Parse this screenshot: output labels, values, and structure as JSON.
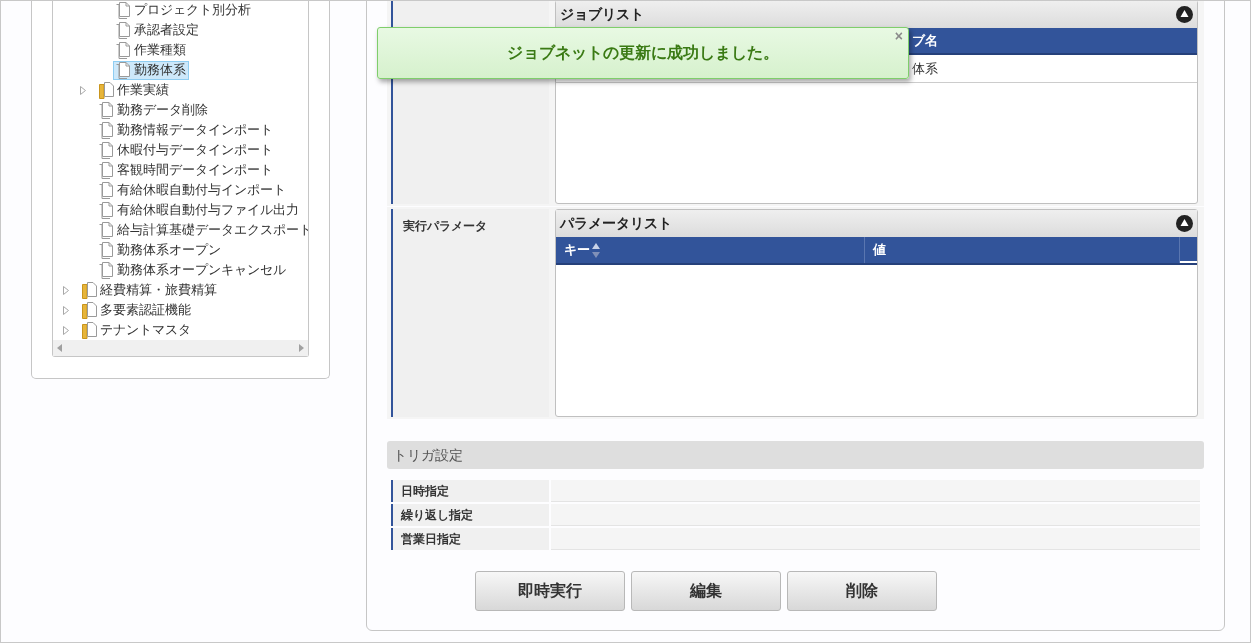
{
  "tree": {
    "items": [
      {
        "kind": "group",
        "children": [
          {
            "kind": "group",
            "children": [
              {
                "kind": "page",
                "label": "プロジェクト別分析",
                "selected": false
              },
              {
                "kind": "page",
                "label": "承認者設定",
                "selected": false
              },
              {
                "kind": "page",
                "label": "作業種類",
                "selected": false
              },
              {
                "kind": "page",
                "label": "勤務体系",
                "selected": true
              }
            ]
          },
          {
            "kind": "folder",
            "label": "作業実績",
            "expanded": false,
            "selected": false
          },
          {
            "kind": "page",
            "label": "勤務データ削除",
            "selected": false
          },
          {
            "kind": "page",
            "label": "勤務情報データインポート",
            "selected": false
          },
          {
            "kind": "page",
            "label": "休暇付与データインポート",
            "selected": false
          },
          {
            "kind": "page",
            "label": "客観時間データインポート",
            "selected": false
          },
          {
            "kind": "page",
            "label": "有給休暇自動付与インポート",
            "selected": false
          },
          {
            "kind": "page",
            "label": "有給休暇自動付与ファイル出力",
            "selected": false
          },
          {
            "kind": "page",
            "label": "給与計算基礎データエクスポート",
            "selected": false
          },
          {
            "kind": "page",
            "label": "勤務体系オープン",
            "selected": false
          },
          {
            "kind": "page",
            "label": "勤務体系オープンキャンセル",
            "selected": false
          }
        ]
      },
      {
        "kind": "folder",
        "label": "経費精算・旅費精算",
        "expanded": false,
        "selected": false
      },
      {
        "kind": "folder",
        "label": "多要素認証機能",
        "expanded": false,
        "selected": false
      },
      {
        "kind": "folder",
        "label": "テナントマスタ",
        "expanded": false,
        "selected": false
      }
    ]
  },
  "job_list": {
    "title": "ジョブリスト",
    "columns": [
      "",
      "ブ名"
    ],
    "rows": [
      [
        "",
        "体系"
      ]
    ]
  },
  "parameters": {
    "label": "実行パラメータ",
    "title": "パラメータリスト",
    "columns": [
      "キー",
      "値"
    ]
  },
  "trigger": {
    "title": "トリガ設定",
    "rows": [
      "日時指定",
      "繰り返し指定",
      "営業日指定"
    ]
  },
  "buttons": [
    "即時実行",
    "編集",
    "削除"
  ],
  "toast": {
    "message": "ジョブネットの更新に成功しました。",
    "close": "×"
  }
}
